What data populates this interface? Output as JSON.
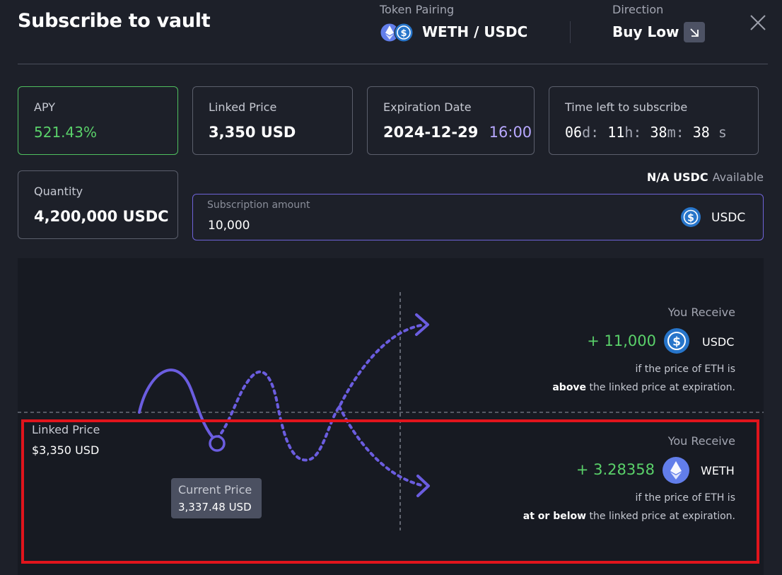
{
  "header": {
    "title": "Subscribe to vault",
    "token_pairing_label": "Token Pairing",
    "token_pairing_value": "WETH / USDC",
    "direction_label": "Direction",
    "direction_value": "Buy Low",
    "direction_icon": "arrow-down-right-icon",
    "close_icon": "close-icon"
  },
  "cards": {
    "apy": {
      "label": "APY",
      "value": "521.43%"
    },
    "linked_price": {
      "label": "Linked Price",
      "value": "3,350 USD"
    },
    "expiration": {
      "label": "Expiration Date",
      "date": "2024-12-29",
      "time": "16:00"
    },
    "time_left": {
      "label": "Time left to subscribe",
      "days": "06",
      "days_unit": "d:",
      "hours": "11",
      "hours_unit": "h:",
      "minutes": "38",
      "minutes_unit": "m:",
      "seconds": "38",
      "seconds_unit": "s"
    },
    "quantity": {
      "label": "Quantity",
      "value": "4,200,000 USDC"
    }
  },
  "available": {
    "amount": "N/A USDC",
    "label": "Available"
  },
  "subscription": {
    "label": "Subscription amount",
    "value": "10,000",
    "token": "USDC"
  },
  "chart": {
    "linked_price_label": "Linked Price",
    "linked_price_value": "$3,350 USD",
    "current_price_label": "Current Price",
    "current_price_value": "3,337.48 USD",
    "above": {
      "label": "You Receive",
      "amount": "+ 11,000",
      "token": "USDC",
      "note_line1": "if the price of ETH is",
      "note_bold": "above",
      "note_rest": "the linked price at expiration."
    },
    "below": {
      "label": "You Receive",
      "amount": "+ 3.28358",
      "token": "WETH",
      "note_line1": "if the price of ETH is",
      "note_bold": "at or below",
      "note_rest": "the linked price at expiration."
    }
  },
  "colors": {
    "background": "#1d2029",
    "panel": "#171a22",
    "accent_purple": "#6f63d8",
    "green": "#5ad16a",
    "highlight_red": "#e0141c",
    "usdc_blue": "#2775ca",
    "eth_purple": "#627eea"
  }
}
